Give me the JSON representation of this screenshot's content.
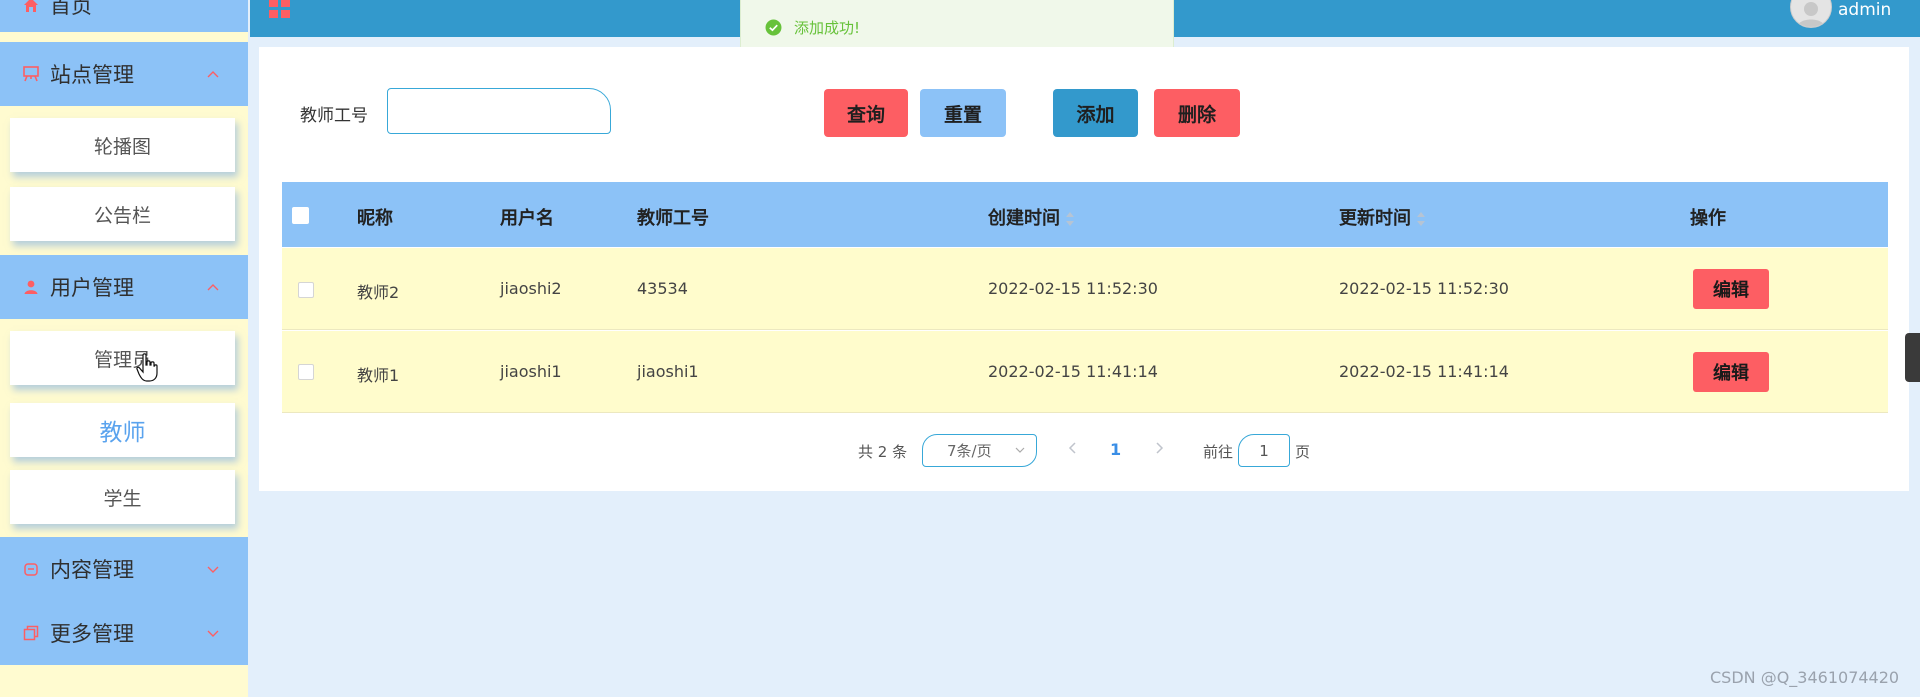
{
  "colors": {
    "sidebar_head": "#8cc2f7",
    "sidebar_bg": "#fffbd0",
    "topbar": "#3399cc",
    "accent_red": "#fd5e63",
    "accent_blue": "#8cc2f7",
    "row_bg": "#fffccc",
    "page_bg": "#e3effb"
  },
  "sidebar": {
    "home": {
      "label": "首页",
      "icon": "home-icon"
    },
    "site_mgmt": {
      "label": "站点管理",
      "icon": "site-icon",
      "expanded": true,
      "items": [
        {
          "label": "轮播图"
        },
        {
          "label": "公告栏"
        }
      ]
    },
    "user_mgmt": {
      "label": "用户管理",
      "icon": "user-icon",
      "expanded": true,
      "items": [
        {
          "label": "管理员"
        },
        {
          "label": "教师",
          "active": true
        },
        {
          "label": "学生"
        }
      ]
    },
    "content_mgmt": {
      "label": "内容管理",
      "icon": "content-icon",
      "expanded": false
    },
    "more_mgmt": {
      "label": "更多管理",
      "icon": "copy-icon",
      "expanded": false
    }
  },
  "topbar": {
    "username": "admin"
  },
  "toast": {
    "message": "添加成功!",
    "type": "success"
  },
  "search": {
    "label": "教师工号",
    "value": ""
  },
  "buttons": {
    "query": "查询",
    "reset": "重置",
    "add": "添加",
    "delete": "删除"
  },
  "table": {
    "headers": {
      "nickname": "昵称",
      "username": "用户名",
      "teacher_no": "教师工号",
      "created": "创建时间",
      "updated": "更新时间",
      "actions": "操作"
    },
    "rows": [
      {
        "nickname": "教师2",
        "username": "jiaoshi2",
        "teacher_no": "43534",
        "created": "2022-02-15 11:52:30",
        "updated": "2022-02-15 11:52:30",
        "action": "编辑"
      },
      {
        "nickname": "教师1",
        "username": "jiaoshi1",
        "teacher_no": "jiaoshi1",
        "created": "2022-02-15 11:41:14",
        "updated": "2022-02-15 11:41:14",
        "action": "编辑"
      }
    ]
  },
  "pagination": {
    "total": "共 2 条",
    "page_size": "7条/页",
    "current": "1",
    "goto_prefix": "前往",
    "goto_value": "1",
    "goto_suffix": "页"
  },
  "watermark": "CSDN @Q_3461074420"
}
